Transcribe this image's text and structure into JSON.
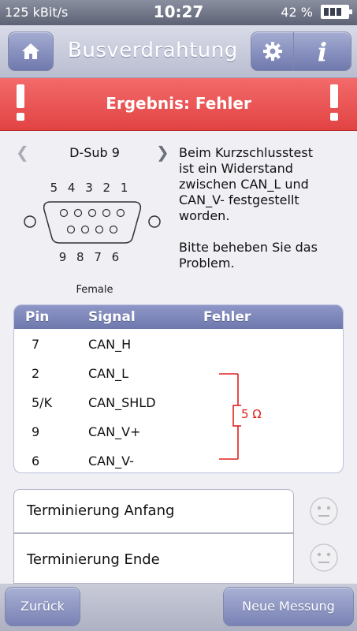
{
  "status_bar": {
    "bitrate": "125 kBit/s",
    "time": "10:27",
    "battery_percent": "42 %",
    "battery_level": 0.42
  },
  "header": {
    "title": "Busverdrahtung",
    "icons": [
      "home-icon",
      "gear-icon",
      "info-icon"
    ],
    "info_glyph": "i"
  },
  "banner": {
    "text": "Ergebnis: Fehler",
    "color": "#e84a4a"
  },
  "connector": {
    "name": "D-Sub 9",
    "top_pins": "5 4 3 2 1",
    "bottom_pins": "9 8 7 6",
    "gender": "Female"
  },
  "message": {
    "text": "Beim Kurzschlusstest\nist ein Widerstand\nzwischen CAN_L und\nCAN_V- festgestellt\nworden.\n\nBitte beheben Sie das\nProblem."
  },
  "pin_table": {
    "headers": {
      "pin": "Pin",
      "signal": "Signal",
      "fault": "Fehler"
    },
    "rows": [
      {
        "pin": "7",
        "signal": "CAN_H"
      },
      {
        "pin": "2",
        "signal": "CAN_L"
      },
      {
        "pin": "5/K",
        "signal": "CAN_SHLD"
      },
      {
        "pin": "9",
        "signal": "CAN_V+"
      },
      {
        "pin": "6",
        "signal": "CAN_V-"
      }
    ],
    "fault": {
      "label": "5 Ω",
      "color": "#e02020",
      "between": [
        "CAN_L",
        "CAN_V-"
      ]
    }
  },
  "terminations": [
    {
      "label": "Terminierung Anfang",
      "status_icon": "neutral-face-icon"
    },
    {
      "label": "Terminierung Ende",
      "status_icon": "neutral-face-icon"
    }
  ],
  "buttons": {
    "back": "Zurück",
    "new_measurement": "Neue Messung"
  }
}
